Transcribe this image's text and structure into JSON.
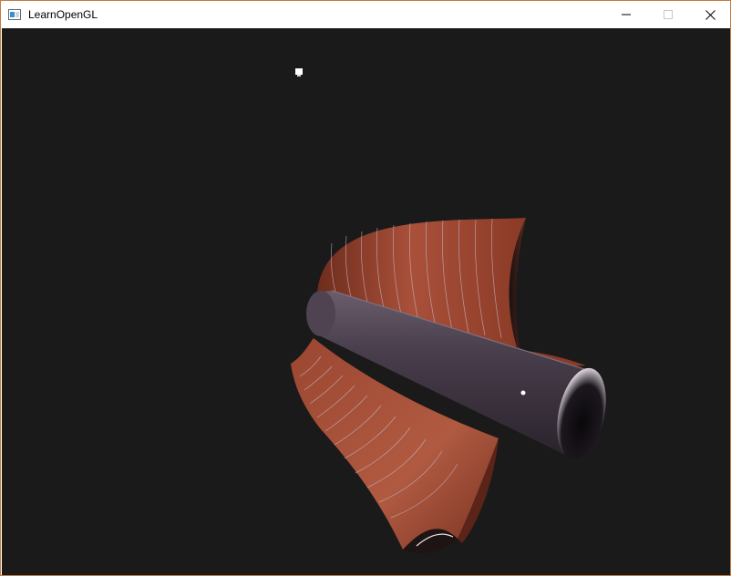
{
  "window": {
    "title": "LearnOpenGL",
    "icons": {
      "app": "app-window-icon",
      "minimize": "minimize-icon",
      "maximize": "maximize-icon",
      "close": "close-icon"
    }
  },
  "viewport": {
    "background": "#1a1a1a",
    "scene_colors": {
      "surface": "#a04a32",
      "cylinder": "#463c48",
      "light": "#ffffff"
    }
  }
}
